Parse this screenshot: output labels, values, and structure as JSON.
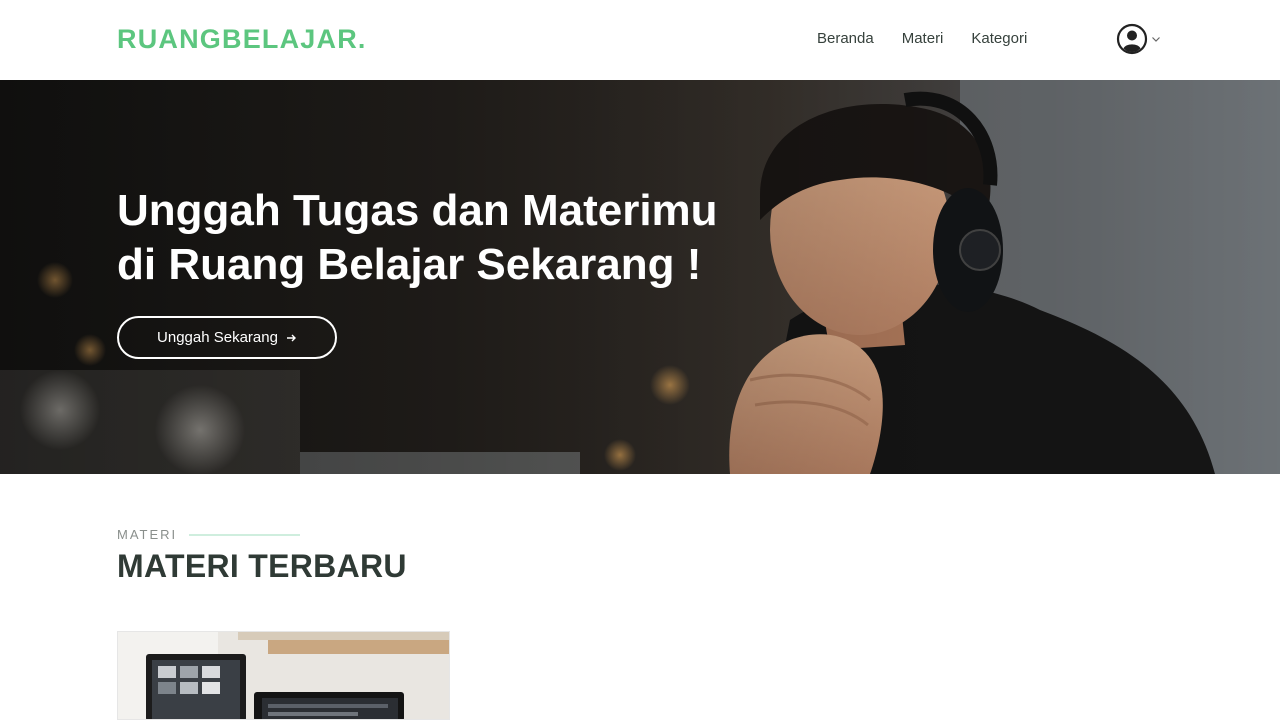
{
  "navbar": {
    "brand": "RUANGBELAJAR.",
    "links": [
      {
        "label": "Beranda"
      },
      {
        "label": "Materi"
      },
      {
        "label": "Kategori"
      }
    ],
    "user_icon": "user-circle-icon",
    "dropdown_icon": "chevron-down-icon"
  },
  "hero": {
    "title_line1": "Unggah Tugas dan Materimu",
    "title_line2": "di Ruang Belajar Sekarang !",
    "cta_label": "Unggah Sekarang",
    "cta_icon": "arrow-right-icon",
    "image": "man-with-headphones-photo"
  },
  "section": {
    "eyebrow": "MATERI",
    "title": "MATERI TERBARU"
  },
  "cards": [
    {
      "image": "desk-computer-monitors-photo"
    }
  ],
  "colors": {
    "brand": "#5cc67f",
    "text_dark": "#2f3a35",
    "eyebrow_line": "#cfeede"
  }
}
